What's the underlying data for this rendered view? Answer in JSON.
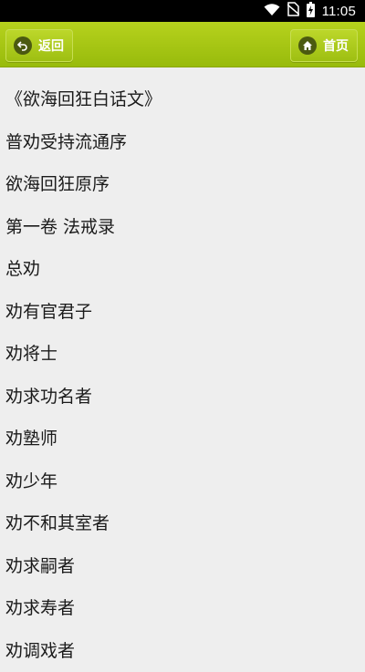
{
  "status_bar": {
    "time": "11:05",
    "icons": [
      "wifi-icon",
      "no-sim-icon",
      "battery-charging-icon"
    ]
  },
  "top_bar": {
    "back_label": "返回",
    "home_label": "首页",
    "accent_color": "#a8c817"
  },
  "chapters": [
    "《欲海回狂白话文》",
    "普劝受持流通序",
    "欲海回狂原序",
    "第一卷 法戒录",
    "总劝",
    "劝有官君子",
    "劝将士",
    "劝求功名者",
    "劝塾师",
    "劝少年",
    "劝不和其室者",
    "劝求嗣者",
    "劝求寿者",
    "劝调戏者"
  ]
}
